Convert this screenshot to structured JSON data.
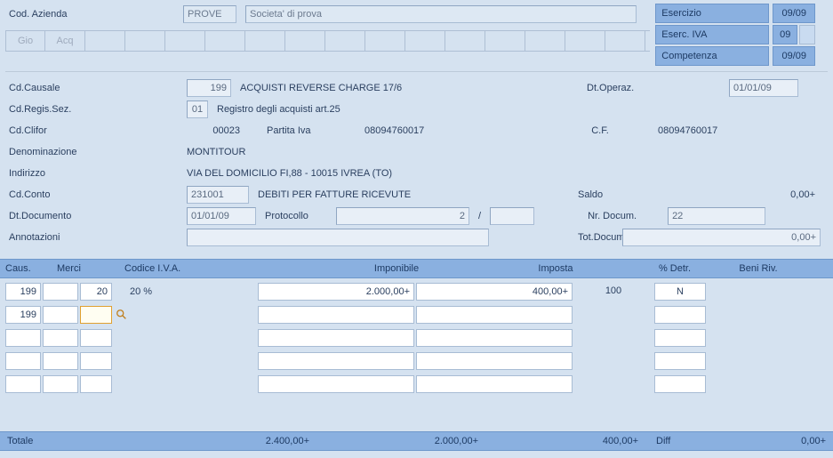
{
  "header": {
    "cod_azienda_label": "Cod. Azienda",
    "cod_azienda_value": "PROVE",
    "societa_value": "Societa' di prova",
    "tabs": [
      "Gio",
      "Acq",
      "",
      "",
      "",
      "",
      "",
      "",
      "",
      "",
      "",
      "",
      "",
      "",
      "",
      ""
    ]
  },
  "right_panel": {
    "esercizio_label": "Esercizio",
    "esercizio_value": "09/09",
    "eserc_iva_label": "Eserc. IVA",
    "eserc_iva_value": "09",
    "competenza_label": "Competenza",
    "competenza_value": "09/09"
  },
  "form": {
    "cd_causale_label": "Cd.Causale",
    "cd_causale_value": "199",
    "causale_desc": "ACQUISTI REVERSE CHARGE 17/6",
    "dt_operaz_label": "Dt.Operaz.",
    "dt_operaz_value": "01/01/09",
    "cd_regis_label": "Cd.Regis.Sez.",
    "cd_regis_value": "01",
    "regis_desc": "Registro degli acquisti art.25",
    "cd_clifor_label": "Cd.Clifor",
    "cd_clifor_value": "00023",
    "partita_iva_label": "Partita Iva",
    "partita_iva_value": "08094760017",
    "cf_label": "C.F.",
    "cf_value": "08094760017",
    "denominazione_label": "Denominazione",
    "denominazione_value": "MONTITOUR",
    "indirizzo_label": "Indirizzo",
    "indirizzo_value": "VIA DEL DOMICILIO FI,88 - 10015 IVREA (TO)",
    "cd_conto_label": "Cd.Conto",
    "cd_conto_value": "231001",
    "conto_desc": "DEBITI PER FATTURE RICEVUTE",
    "saldo_label": "Saldo",
    "saldo_value": "0,00+",
    "dt_documento_label": "Dt.Documento",
    "dt_documento_value": "01/01/09",
    "protocollo_label": "Protocollo",
    "protocollo_value": "2",
    "protocollo_sep": "/",
    "nr_docum_label": "Nr. Docum.",
    "nr_docum_value": "22",
    "annotazioni_label": "Annotazioni",
    "annotazioni_value": "",
    "tot_docum_label": "Tot.Docum.",
    "tot_docum_value": "0,00+"
  },
  "grid": {
    "headers": {
      "caus": "Caus.",
      "merci": "Merci",
      "codice_iva": "Codice I.V.A.",
      "imponibile": "Imponibile",
      "imposta": "Imposta",
      "detr": "% Detr.",
      "beni": "Beni Riv."
    },
    "rows": [
      {
        "caus": "199",
        "merci": "",
        "iva": "20",
        "iva_desc": "20 %",
        "imponibile": "2.000,00+",
        "imposta": "400,00+",
        "detr": "100",
        "beni": "N"
      },
      {
        "caus": "199",
        "merci": "",
        "iva": "",
        "iva_desc": "",
        "imponibile": "",
        "imposta": "",
        "detr": "",
        "beni": ""
      },
      {
        "caus": "",
        "merci": "",
        "iva": "",
        "iva_desc": "",
        "imponibile": "",
        "imposta": "",
        "detr": "",
        "beni": ""
      },
      {
        "caus": "",
        "merci": "",
        "iva": "",
        "iva_desc": "",
        "imponibile": "",
        "imposta": "",
        "detr": "",
        "beni": ""
      },
      {
        "caus": "",
        "merci": "",
        "iva": "",
        "iva_desc": "",
        "imponibile": "",
        "imposta": "",
        "detr": "",
        "beni": ""
      }
    ]
  },
  "footer": {
    "totale_label": "Totale",
    "totale_value": "2.400,00+",
    "imponibile_sum": "2.000,00+",
    "imposta_sum": "400,00+",
    "diff_label": "Diff",
    "diff_value": "0,00+"
  }
}
